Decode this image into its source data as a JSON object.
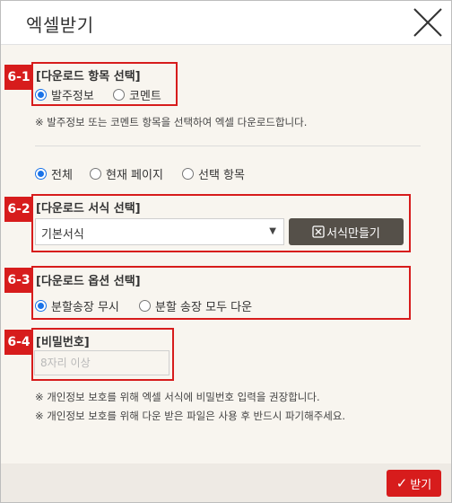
{
  "dialog": {
    "title": "엑셀받기"
  },
  "sections": {
    "item": {
      "tag": "6-1",
      "title": "[다운로드 항목 선택]",
      "options": [
        "발주정보",
        "코멘트"
      ],
      "selected": 0
    },
    "note_item": "※ 발주정보 또는 코멘트 항목을 선택하여 엑셀 다운로드합니다.",
    "range": {
      "options": [
        "전체",
        "현재 페이지",
        "선택 항목"
      ],
      "selected": 0
    },
    "format": {
      "tag": "6-2",
      "title": "[다운로드 서식 선택]",
      "select_value": "기본서식",
      "make_button": "서식만들기"
    },
    "option": {
      "tag": "6-3",
      "title": "[다운로드 옵션 선택]",
      "options": [
        "분할송장 무시",
        "분할 송장 모두 다운"
      ],
      "selected": 0
    },
    "password": {
      "tag": "6-4",
      "title": "[비밀번호]",
      "placeholder": "8자리 이상"
    },
    "notes": [
      "※ 개인정보 보호를 위해 엑셀 서식에 비밀번호 입력을 권장합니다.",
      "※ 개인정보 보호를 위해 다운 받은 파일은 사용 후 반드시 파기해주세요."
    ]
  },
  "footer": {
    "receive_button": "받기"
  },
  "colors": {
    "accent": "#d71c1c",
    "radio": "#1a73e8",
    "dark_button": "#555049",
    "background": "#f8f5ef"
  },
  "icons": {
    "close": "close-icon",
    "excel": "excel-icon",
    "check": "check-icon"
  }
}
